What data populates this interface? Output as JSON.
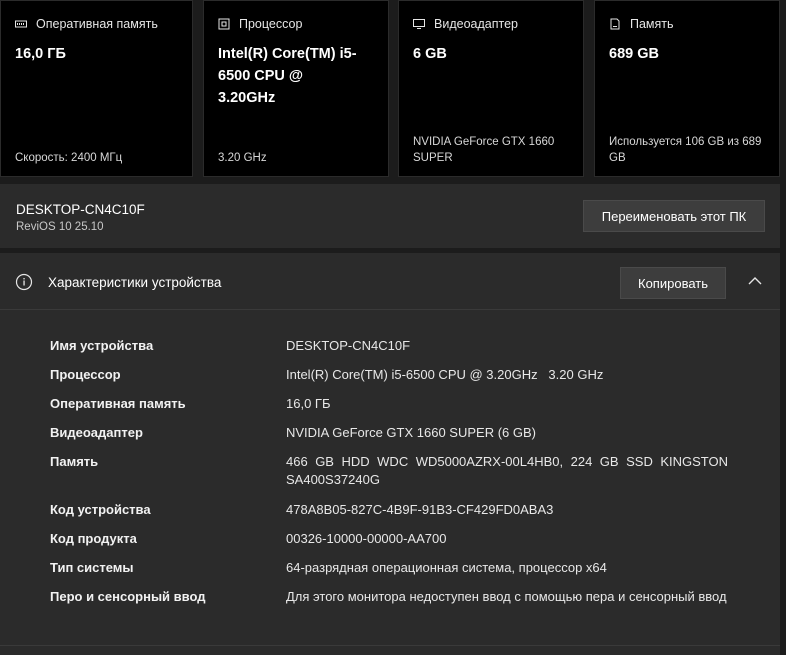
{
  "cards": [
    {
      "title": "Оперативная память",
      "icon": "memory-chip-icon",
      "value": "16,0 ГБ",
      "footer": "Скорость: 2400 МГц"
    },
    {
      "title": "Процессор",
      "icon": "processor-chip-icon",
      "value": "Intel(R) Core(TM) i5-6500 CPU @ 3.20GHz",
      "footer": "3.20 GHz"
    },
    {
      "title": "Видеоадаптер",
      "icon": "display-adapter-icon",
      "value": "6 GB",
      "footer": "NVIDIA GeForce GTX 1660 SUPER"
    },
    {
      "title": "Память",
      "icon": "storage-drive-icon",
      "value": "689 GB",
      "footer": "Используется 106 GB из 689 GB"
    }
  ],
  "device": {
    "name": "DESKTOP-CN4C10F",
    "os": "ReviOS 10 25.10",
    "rename_label": "Переименовать этот ПК"
  },
  "specs": {
    "title": "Характеристики устройства",
    "info_icon": "info-icon",
    "copy_label": "Копировать",
    "collapse_icon": "chevron-up-icon",
    "rows": [
      {
        "label": "Имя устройства",
        "value": "DESKTOP-CN4C10F"
      },
      {
        "label": "Процессор",
        "value": "Intel(R) Core(TM) i5-6500 CPU @ 3.20GHz   3.20 GHz"
      },
      {
        "label": "Оперативная память",
        "value": "16,0 ГБ"
      },
      {
        "label": "Видеоадаптер",
        "value": "NVIDIA GeForce GTX 1660 SUPER (6 GB)"
      },
      {
        "label": "Память",
        "value": "466 GB HDD WDC WD5000AZRX-00L4HB0, 224 GB SSD KINGSTON SA400S37240G"
      },
      {
        "label": "Код устройства",
        "value": "478A8B05-827C-4B9F-91B3-CF429FD0ABA3"
      },
      {
        "label": "Код продукта",
        "value": "00326-10000-00000-AA700"
      },
      {
        "label": "Тип системы",
        "value": "64-разрядная операционная система, процессор x64"
      },
      {
        "label": "Перо и сенсорный ввод",
        "value": "Для этого монитора недоступен ввод с помощью пера и сенсорный ввод"
      }
    ]
  }
}
